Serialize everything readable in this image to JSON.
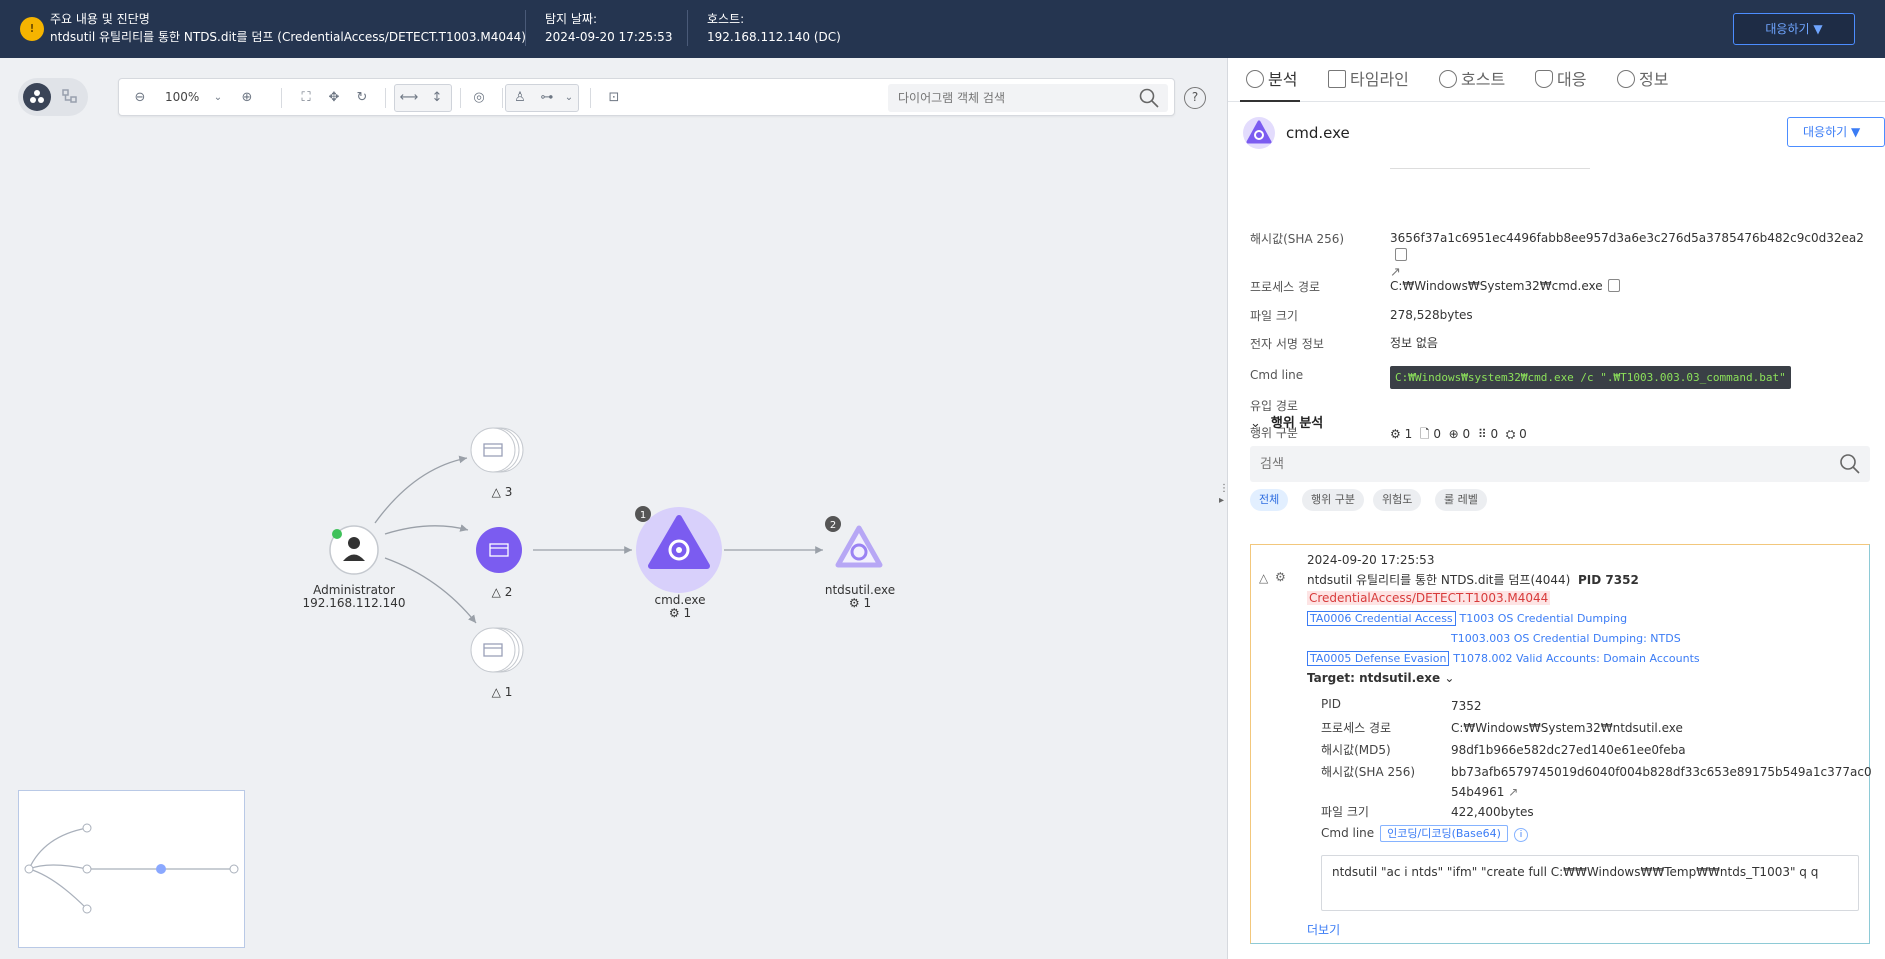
{
  "topbar": {
    "alert_icon": "!",
    "main_label": "주요 내용 및 진단명",
    "main_value": "ntdsutil 유틸리티를 통한 NTDS.dit를 덤프 (CredentialAccess/DETECT.T1003.M4044)",
    "date_label": "탐지 날짜:",
    "date_value": "2024-09-20 17:25:53",
    "host_label": "호스트:",
    "host_value": "192.168.112.140 (DC)",
    "action_label": "대응하기 ▼"
  },
  "toolbar": {
    "zoom": "100%",
    "search_placeholder": "다이어그램 객체 검색",
    "help": "?"
  },
  "graph": {
    "user_name": "Administrator",
    "user_ip": "192.168.112.140",
    "group_top_count": "3",
    "group_mid_count": "2",
    "group_bot_count": "1",
    "cmd_badge": "1",
    "cmd_name": "cmd.exe",
    "cmd_count": "1",
    "ntds_badge": "2",
    "ntds_name": "ntdsutil.exe",
    "ntds_count": "1"
  },
  "panel": {
    "tabs": [
      "분석",
      "타임라인",
      "호스트",
      "대응",
      "정보"
    ],
    "process_name": "cmd.exe",
    "action_label": "대응하기 ▼",
    "props": {
      "hash_label": "해시값(SHA 256)",
      "hash_value": "3656f37a1c6951ec4496fabb8ee957d3a6e3c276d5a3785476b482c9c0d32ea2",
      "path_label": "프로세스 경로",
      "path_value": "C:₩Windows₩System32₩cmd.exe",
      "size_label": "파일 크기",
      "size_value": "278,528bytes",
      "sig_label": "전자 서명 정보",
      "sig_value": "정보 없음",
      "cmd_label": "Cmd line",
      "cmd_value": "C:₩Windows₩system32₩cmd.exe /c \".₩T1003.003.03_command.bat\"",
      "inflow_label": "유입 경로",
      "behavior_label": "행위 구분",
      "behavior_counts": [
        "1",
        "0",
        "0",
        "0",
        "0"
      ]
    },
    "analysis": {
      "title": "행위 분석",
      "search_placeholder": "검색",
      "filters": [
        "전체",
        "행위 구분",
        "위험도",
        "룰 레벨"
      ]
    },
    "card": {
      "time": "2024-09-20 17:25:53",
      "title": "ntdsutil 유틸리티를 통한 NTDS.dit를 덤프(4044)",
      "pid_title": "PID 7352",
      "rule": "CredentialAccess/DETECT.T1003.M4044",
      "tactic1": "TA0006 Credential Access",
      "tech1a": "T1003 OS Credential Dumping",
      "tech1b": "T1003.003 OS Credential Dumping: NTDS",
      "tactic2": "TA0005 Defense Evasion",
      "tech2": "T1078.002 Valid Accounts: Domain Accounts",
      "target": "Target: ntdsutil.exe",
      "pid_label": "PID",
      "pid_value": "7352",
      "path_label": "프로세스 경로",
      "path_value": "C:₩Windows₩System32₩ntdsutil.exe",
      "md5_label": "해시값(MD5)",
      "md5_value": "98df1b966e582dc27ed140e61ee0feba",
      "sha_label": "해시값(SHA 256)",
      "sha_value_1": "bb73afb6579745019d6040f004b828df33c653e89175b549a1c377ac0",
      "sha_value_2": "54b4961",
      "size_label": "파일 크기",
      "size_value": "422,400bytes",
      "cmd_label": "Cmd line",
      "enc_btn": "인코딩/디코딩(Base64)",
      "cmd_value": "ntdsutil  \"ac i ntds\" \"ifm\" \"create full C:₩₩Windows₩₩Temp₩₩ntds_T1003\" q q",
      "more": "더보기"
    }
  },
  "colors": {
    "topbar_bg": "#253550",
    "accent": "#3b7cf5",
    "process_purple": "#7b5cf0",
    "rule_red": "#d83b3b"
  }
}
